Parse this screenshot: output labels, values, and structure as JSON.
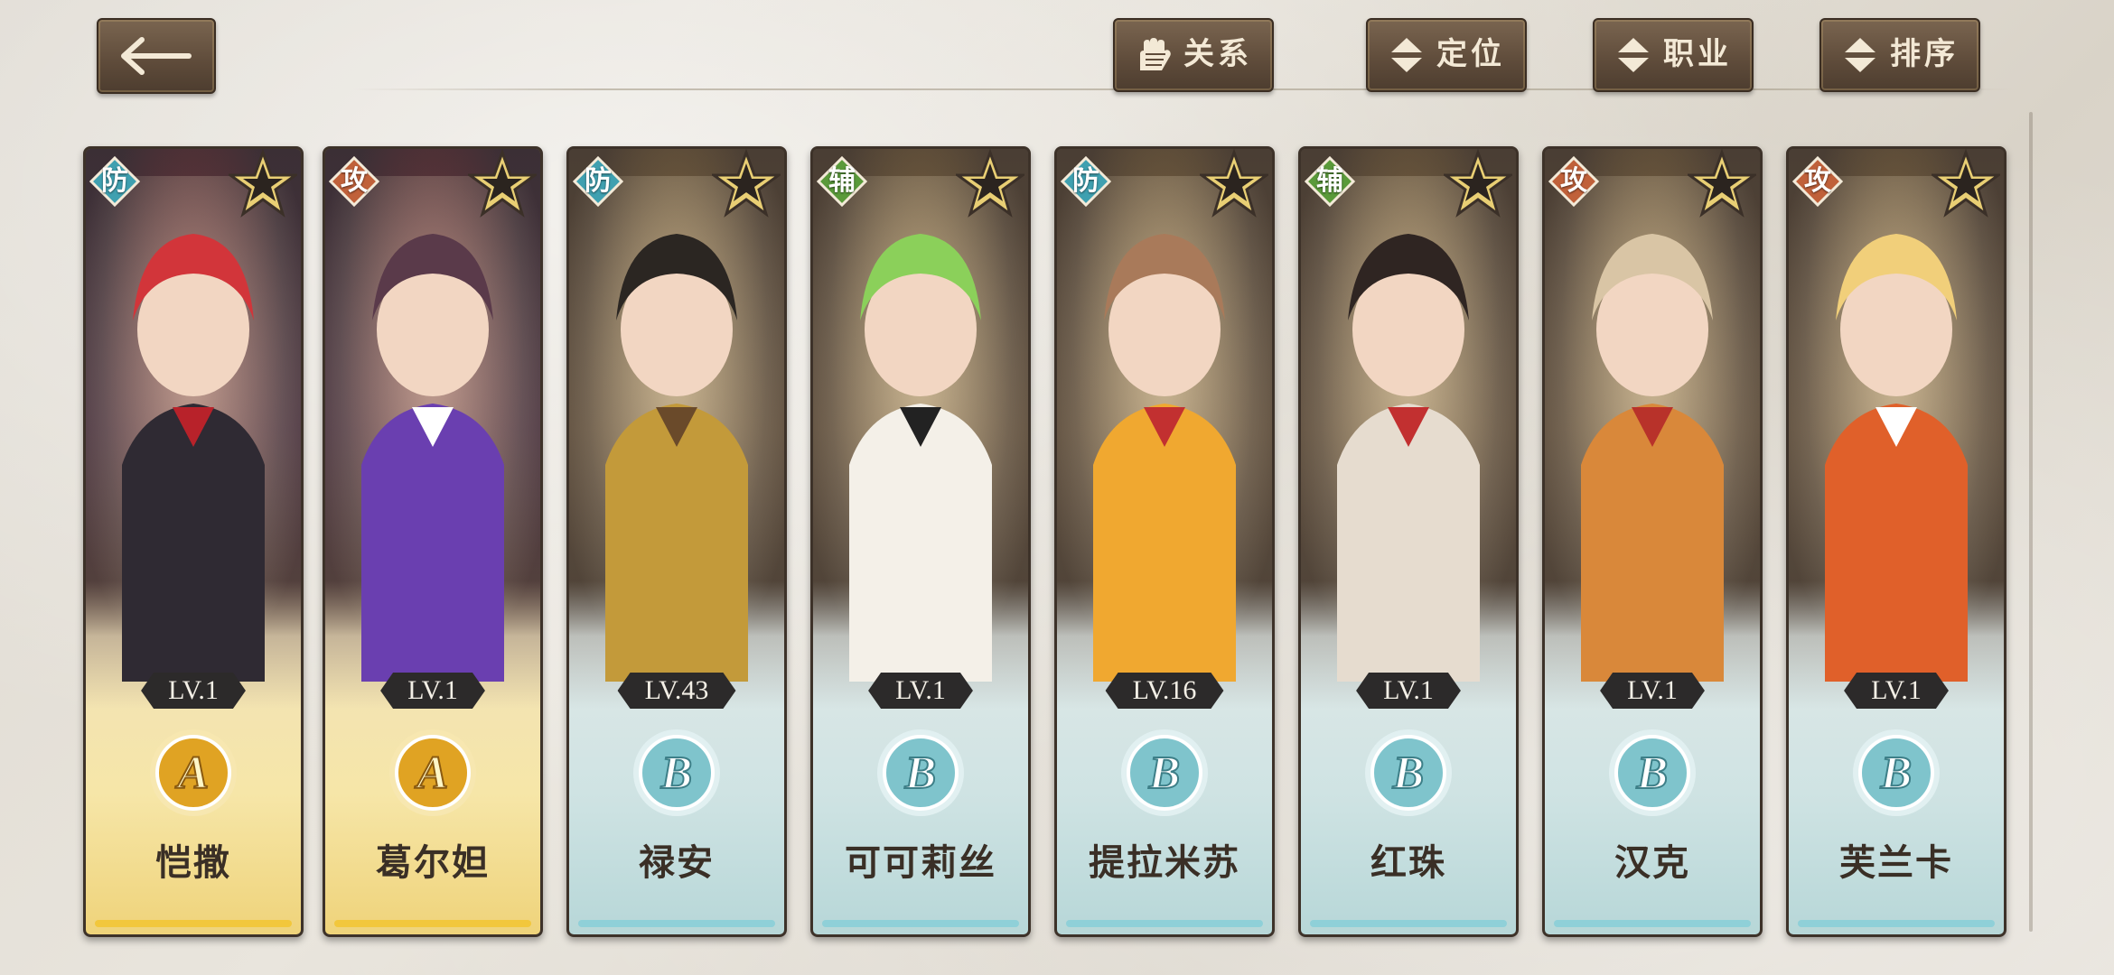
{
  "toolbar": {
    "back_label": "返回",
    "filters": [
      {
        "label": "关系",
        "icon": "glove-icon"
      },
      {
        "label": "定位",
        "icon": "sort-arrows-icon"
      },
      {
        "label": "职业",
        "icon": "sort-arrows-icon"
      },
      {
        "label": "排序",
        "icon": "sort-arrows-icon"
      }
    ]
  },
  "colors": {
    "defense_badge": "#3fa0b0",
    "attack_badge": "#c0613a",
    "support_badge": "#5a9a3a",
    "rank_a_gold": "#e0a323",
    "rank_b_teal": "#7fc4cc",
    "button_brown": "#5e4b3a"
  },
  "cards": [
    {
      "name": "恺撒",
      "role": "防",
      "level": "LV.1",
      "rank": "A",
      "rarity": "gold"
    },
    {
      "name": "葛尔妲",
      "role": "攻",
      "level": "LV.1",
      "rank": "A",
      "rarity": "gold"
    },
    {
      "name": "禄安",
      "role": "防",
      "level": "LV.43",
      "rank": "B",
      "rarity": "teal"
    },
    {
      "name": "可可莉丝",
      "role": "辅",
      "level": "LV.1",
      "rank": "B",
      "rarity": "teal"
    },
    {
      "name": "提拉米苏",
      "role": "防",
      "level": "LV.16",
      "rank": "B",
      "rarity": "teal"
    },
    {
      "name": "红珠",
      "role": "辅",
      "level": "LV.1",
      "rank": "B",
      "rarity": "teal"
    },
    {
      "name": "汉克",
      "role": "攻",
      "level": "LV.1",
      "rank": "B",
      "rarity": "teal"
    },
    {
      "name": "芙兰卡",
      "role": "攻",
      "level": "LV.1",
      "rank": "B",
      "rarity": "teal"
    }
  ]
}
